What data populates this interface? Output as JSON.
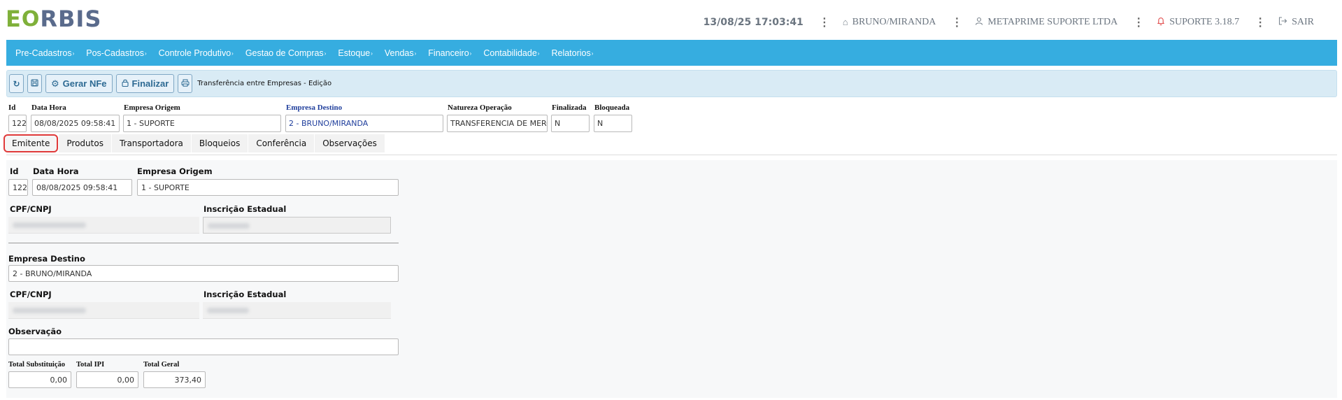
{
  "header": {
    "logo_e": "E",
    "logo_o": "O",
    "logo_rest": "RBIS",
    "datetime": "13/08/25 17:03:41",
    "branch": "BRUNO/MIRANDA",
    "user_company": "METAPRIME SUPORTE LTDA",
    "version": "SUPORTE 3.18.7",
    "logout": "SAIR",
    "icons": {
      "branch": "home-icon",
      "user": "user-icon",
      "version": "bell-icon",
      "logout": "logout-icon",
      "menu": "kebab-icon"
    }
  },
  "nav": {
    "items": [
      "Pre-Cadastros",
      "Pos-Cadastros",
      "Controle Produtivo",
      "Gestao de Compras",
      "Estoque",
      "Vendas",
      "Financeiro",
      "Contabilidade",
      "Relatorios"
    ],
    "chevron": "›"
  },
  "toolbar": {
    "gerar_nfe": "Gerar NFe",
    "finalizar": "Finalizar",
    "breadcrumb": "Transferência entre Empresas - Edição",
    "icons": {
      "refresh": "refresh-icon",
      "save": "save-icon",
      "gear": "gear-icon",
      "lock": "lock-icon",
      "print": "print-icon"
    }
  },
  "form": {
    "labels": {
      "id": "Id",
      "data_hora": "Data Hora",
      "empresa_origem": "Empresa Origem",
      "empresa_destino": "Empresa Destino",
      "natureza": "Natureza Operação",
      "finalizada": "Finalizada",
      "bloqueada": "Bloqueada"
    },
    "values": {
      "id": "122",
      "data_hora": "08/08/2025 09:58:41",
      "empresa_origem": "1 - SUPORTE",
      "empresa_destino": "2 - BRUNO/MIRANDA",
      "natureza": "TRANSFERENCIA DE MERCADORIA",
      "finalizada": "N",
      "bloqueada": "N"
    }
  },
  "tabs": [
    "Emitente",
    "Produtos",
    "Transportadora",
    "Bloqueios",
    "Conferência",
    "Observações"
  ],
  "active_tab": "Emitente",
  "emitente": {
    "labels": {
      "id": "Id",
      "data_hora": "Data Hora",
      "empresa_origem": "Empresa Origem",
      "cpf_cnpj": "CPF/CNPJ",
      "inscricao": "Inscrição Estadual",
      "empresa_destino": "Empresa Destino",
      "cpf_cnpj2": "CPF/CNPJ",
      "inscricao2": "Inscrição Estadual",
      "observacao": "Observação"
    },
    "values": {
      "id": "122",
      "data_hora": "08/08/2025 09:58:41",
      "empresa_origem": "1 - SUPORTE",
      "empresa_destino": "2 - BRUNO/MIRANDA",
      "observacao": ""
    }
  },
  "totals": {
    "labels": {
      "substituicao": "Total Substituição",
      "ipi": "Total IPI",
      "geral": "Total Geral"
    },
    "values": {
      "substituicao": "0,00",
      "ipi": "0,00",
      "geral": "373,40"
    }
  },
  "colors": {
    "nav_bg": "#36ade0",
    "toolbar_bg": "#d9ebf5",
    "logo_green": "#7fb03a",
    "logo_blue": "#5a6b8c",
    "active_tab_border": "#e03a3a",
    "destino_label": "#1f3e9c"
  }
}
